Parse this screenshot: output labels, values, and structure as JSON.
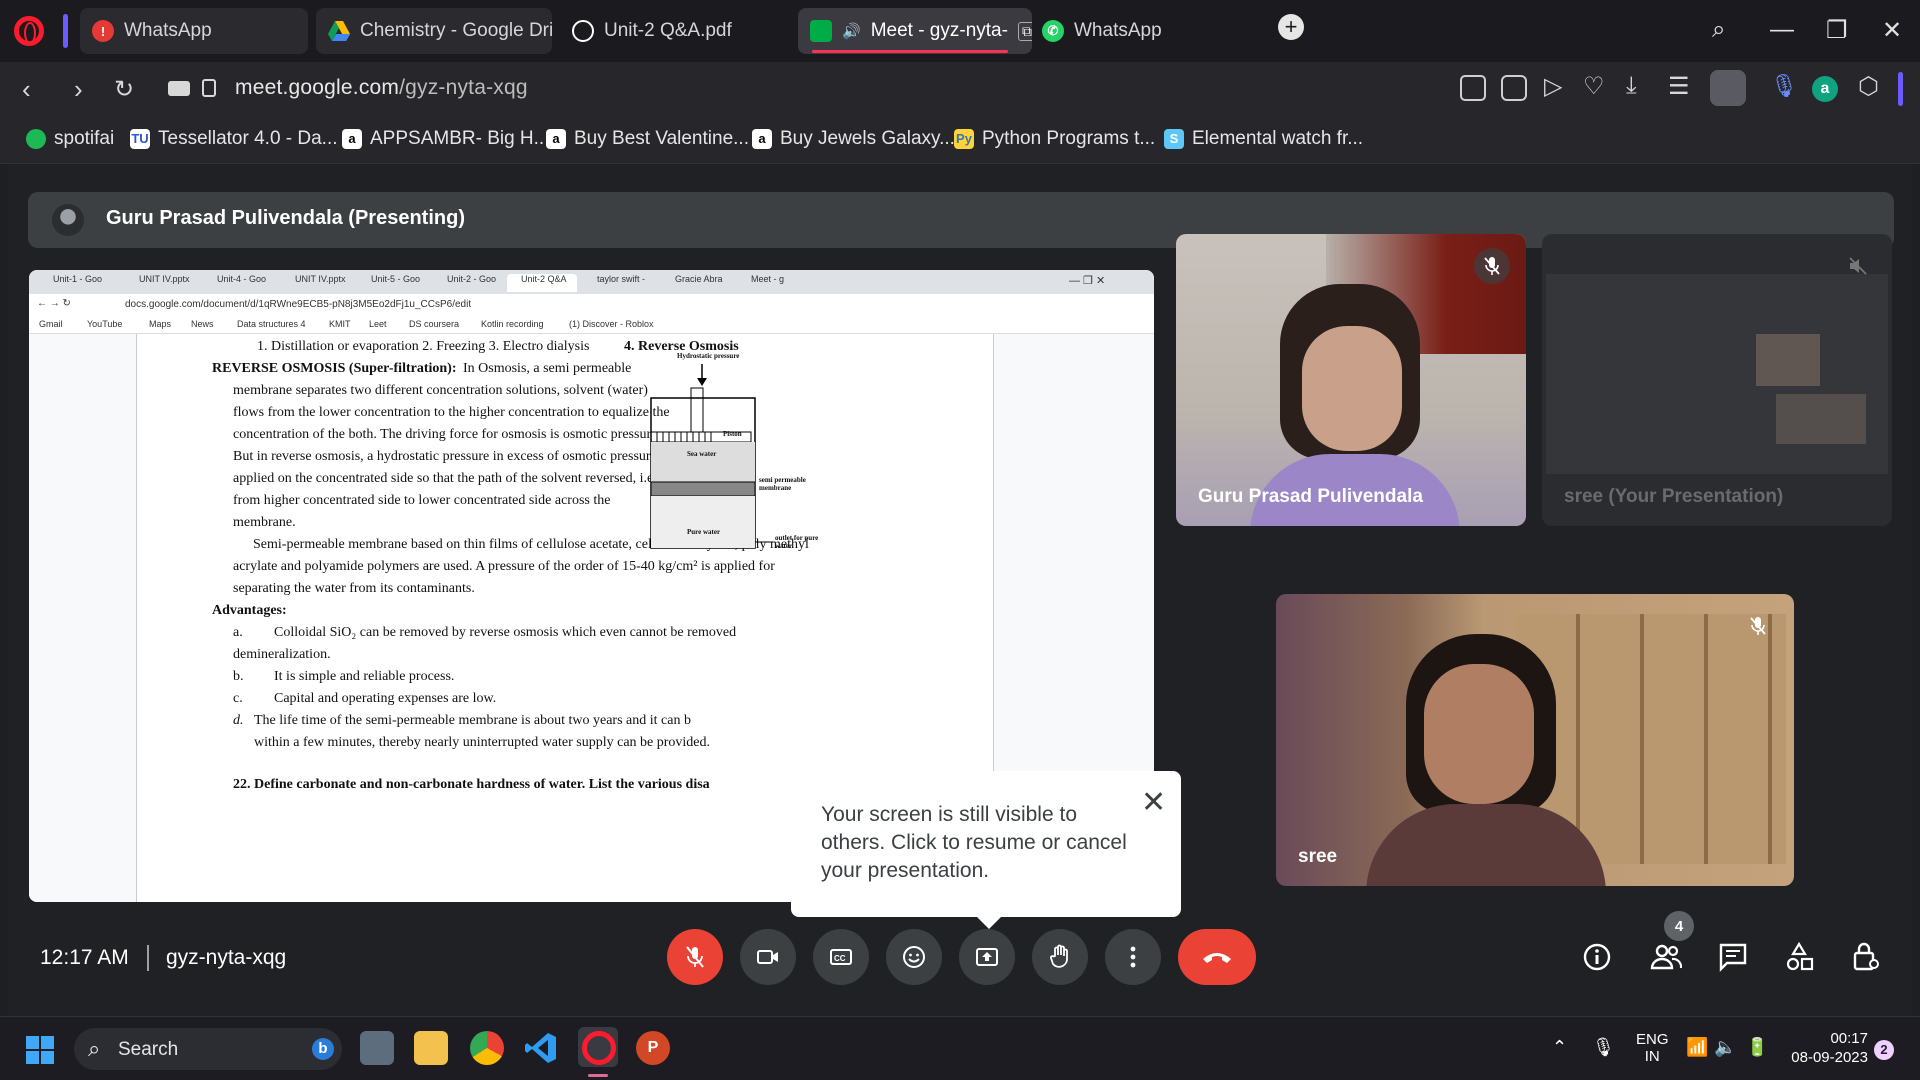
{
  "browser": {
    "tabs": [
      {
        "label": "WhatsApp",
        "icon": "warning-icon",
        "icon_color": "#e53935"
      },
      {
        "label": "Chemistry - Google Driv",
        "icon": "drive-icon",
        "icon_color": "#fbbc04"
      },
      {
        "label": "Unit-2 Q&A.pdf",
        "icon": "globe-icon",
        "icon_color": "#ffffff"
      },
      {
        "label": "Meet - gyz-nyta-",
        "icon": "meet-icon",
        "icon_color": "#00ac47"
      },
      {
        "label": "WhatsApp",
        "icon": "whatsapp-icon",
        "icon_color": "#25d366"
      }
    ],
    "url_host": "meet.google.com",
    "url_path": "/gyz-nyta-xqg",
    "bookmarks": [
      {
        "label": "spotifai",
        "icon": "spotify-icon",
        "color": "#1db954"
      },
      {
        "label": "Tessellator 4.0 - Da...",
        "icon": "tu-icon",
        "color": "#ffffff"
      },
      {
        "label": "APPSAMBR- Big H...",
        "icon": "amazon-icon",
        "color": "#ffffff"
      },
      {
        "label": "Buy Best Valentine...",
        "icon": "amazon-icon",
        "color": "#ffffff"
      },
      {
        "label": "Buy Jewels Galaxy...",
        "icon": "amazon-icon",
        "color": "#ffffff"
      },
      {
        "label": "Python Programs t...",
        "icon": "python-icon",
        "color": "#ffd43b"
      },
      {
        "label": "Elemental watch fr...",
        "icon": "s-icon",
        "color": "#5ec7f8"
      }
    ]
  },
  "meet": {
    "presenter_banner": "Guru Prasad Pulivendala (Presenting)",
    "shared_screen": {
      "tabs": [
        "Unit-1 - Goo",
        "UNIT IV.pptx",
        "Unit-4 - Goo",
        "UNIT IV.pptx",
        "Unit-5 - Goo",
        "Unit-2 - Goo",
        "Unit-2 Q&A",
        "taylor swift -",
        "Gracie Abra",
        "Meet - g"
      ],
      "url": "docs.google.com/document/d/1qRWne9ECB5-pN8j3M5Eo2dFj1u_CCsP6/edit",
      "bookmarks": [
        "Gmail",
        "YouTube",
        "Maps",
        "News",
        "Data structures 4",
        "KMIT",
        "Leet",
        "DS coursera",
        "Kotlin recording",
        "(1) Discover - Roblox"
      ],
      "doc": {
        "methods_line": "1. Distillation or evaporation     2. Freezing     3. Electro dialysis",
        "methods_last": "4. Reverse Osmosis",
        "ro_heading": "REVERSE OSMOSIS (Super-filtration):",
        "ro_lines": [
          "In Osmosis, a semi permeable",
          "membrane separates two different concentration solutions, solvent (water)",
          "flows from the lower concentration to the higher concentration to equalize the",
          "concentration of the both. The driving force for osmosis is osmotic pressure.",
          "But in reverse osmosis, a hydrostatic pressure in excess of osmotic pressure is",
          "applied on the concentrated side so that the path of the solvent reversed, i.e.,",
          "from higher concentrated side to lower concentrated side across the",
          "membrane."
        ],
        "para2": [
          "Semi-permeable membrane based on thin films of cellulose acetate, cellulose butyrate, poly methyl",
          "acrylate and polyamide polymers are used. A pressure of the order of 15-40 kg/cm² is applied for",
          "separating the water from its contaminants."
        ],
        "advantages_heading": "Advantages:",
        "adv": [
          {
            "k": "a.",
            "t": "Colloidal SiO₂ can be removed by reverse osmosis which even cannot be removed"
          },
          {
            "k": "",
            "t": "demineralization."
          },
          {
            "k": "b.",
            "t": "It is simple and reliable process."
          },
          {
            "k": "c.",
            "t": "Capital and operating expenses are low."
          },
          {
            "k": "d.",
            "t": "The life time of the semi-permeable membrane is about two years and it can b"
          },
          {
            "k": "",
            "t": "within a few minutes, thereby nearly uninterrupted water supply can be provided."
          }
        ],
        "question": "22. Define carbonate and non-carbonate hardness of water. List the various disa",
        "diagram_labels": {
          "top": "Hydrostatic pressure",
          "piston": "Piston",
          "sea": "Sea water",
          "membrane": "semi permeable membrane",
          "pure": "Pure water",
          "outlet": "outlet for pure water"
        }
      }
    },
    "participants": [
      {
        "name": "Guru Prasad Pulivendala"
      },
      {
        "name": "sree (Your Presentation)"
      },
      {
        "name": "sree"
      }
    ],
    "popup": {
      "text": "Your screen is still visible to others. Click to resume or cancel your presentation."
    },
    "footer": {
      "time": "12:17 AM",
      "meeting_code": "gyz-nyta-xqg",
      "people_count": "4"
    }
  },
  "taskbar": {
    "search_label": "Search",
    "lang_line1": "ENG",
    "lang_line2": "IN",
    "time": "00:17",
    "date": "08-09-2023",
    "notification_count": "2"
  }
}
